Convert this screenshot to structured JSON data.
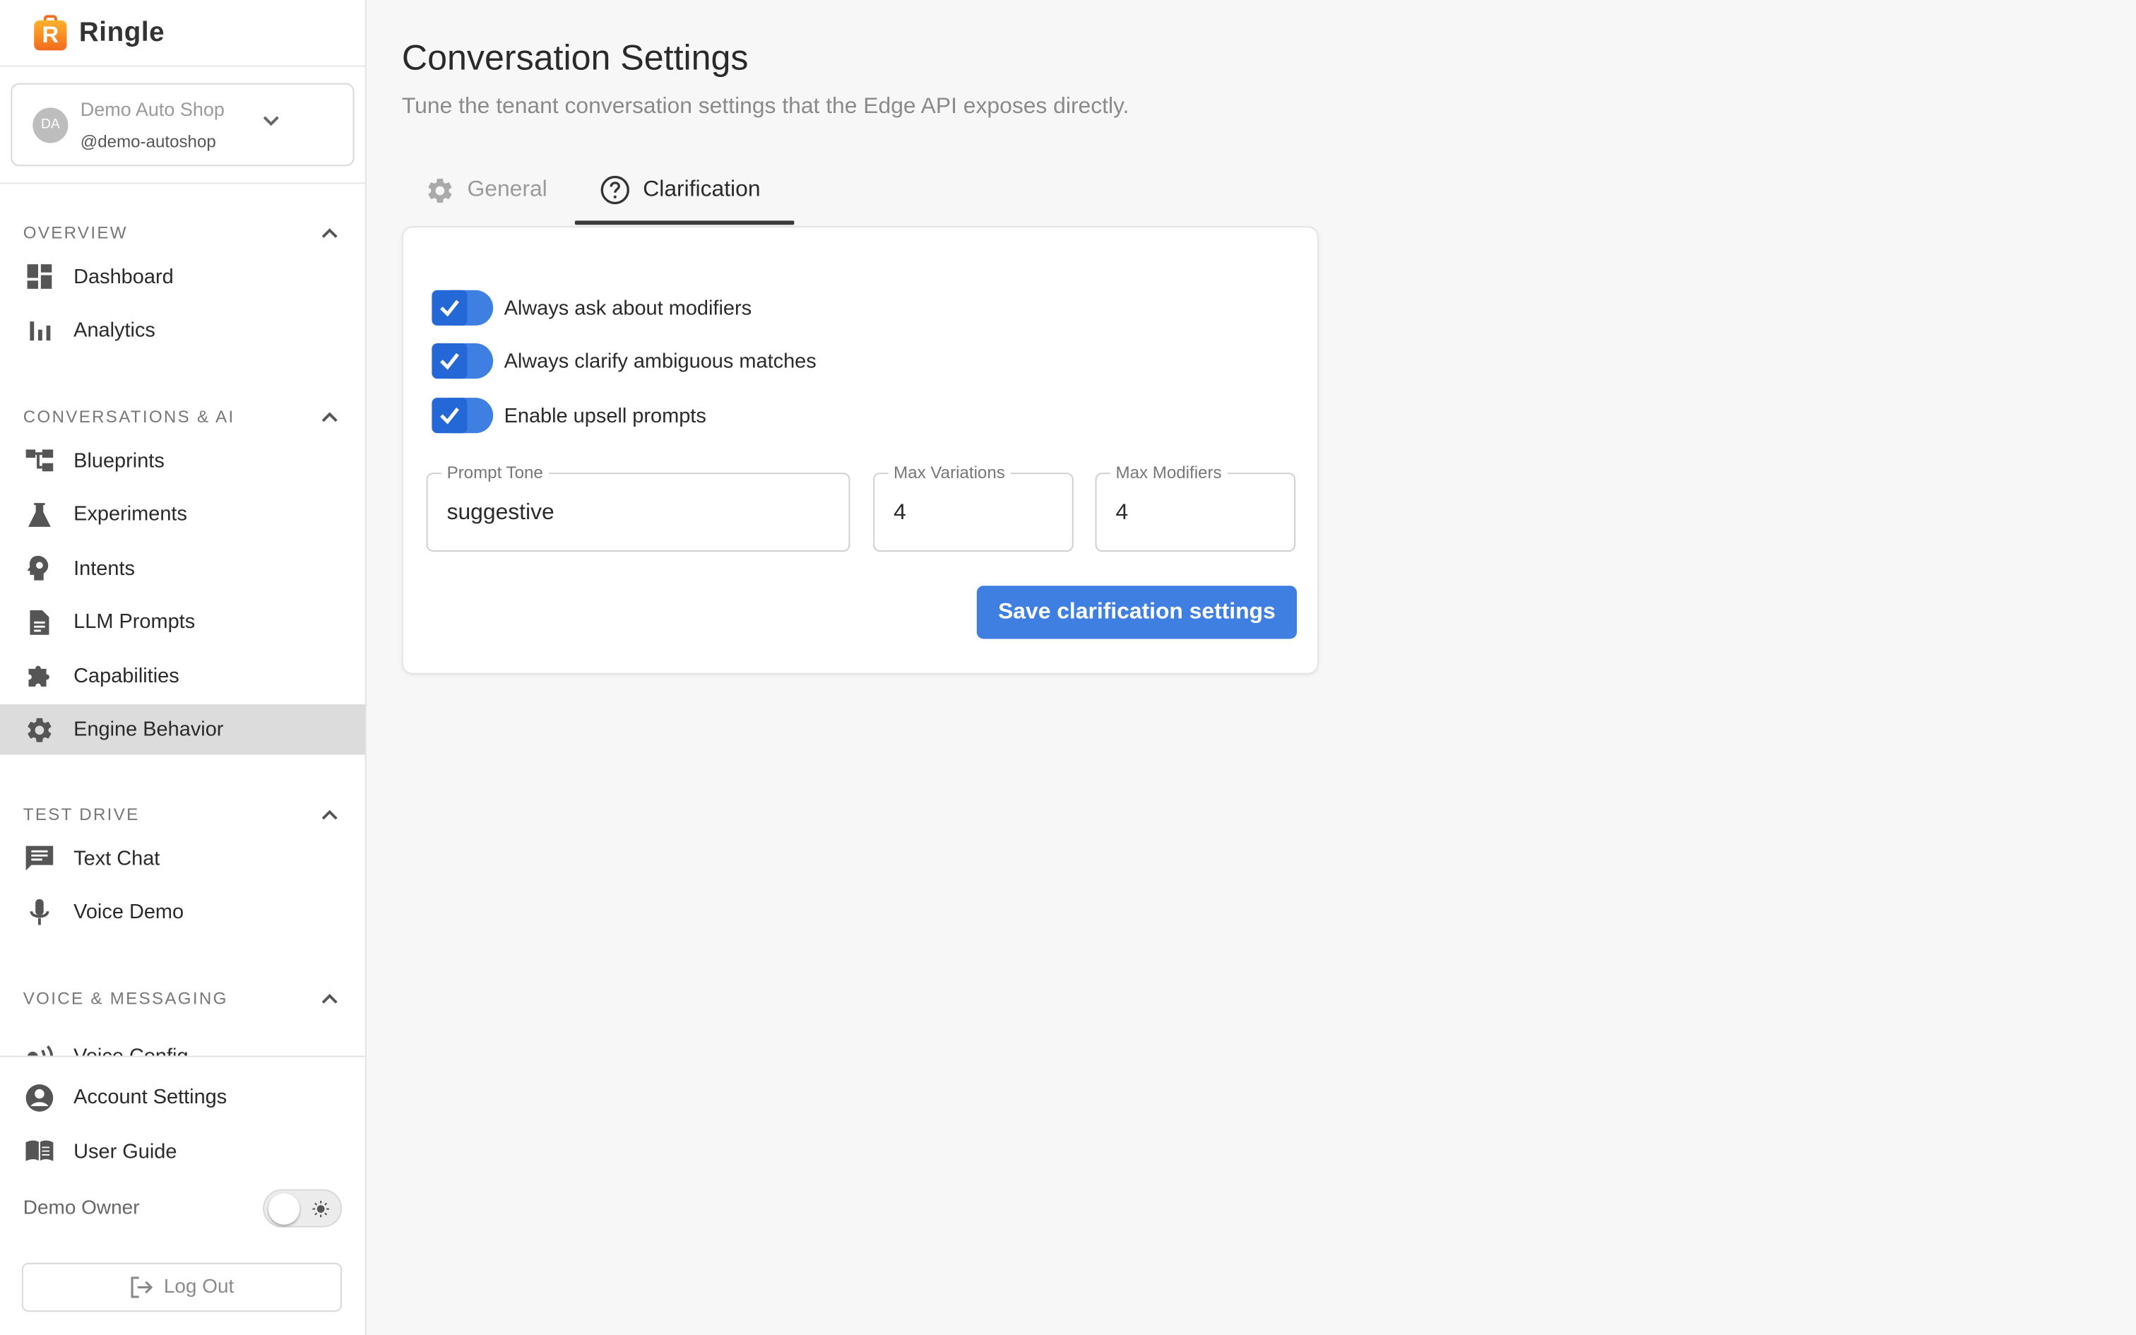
{
  "app": {
    "name": "Ringle"
  },
  "tenant": {
    "initials": "DA",
    "name": "Demo Auto Shop",
    "handle": "@demo-autoshop"
  },
  "sidebar": {
    "sections": [
      {
        "label": "OVERVIEW",
        "items": [
          {
            "label": "Dashboard",
            "icon": "dashboard-icon"
          },
          {
            "label": "Analytics",
            "icon": "bar-chart-icon"
          }
        ]
      },
      {
        "label": "CONVERSATIONS & AI",
        "items": [
          {
            "label": "Blueprints",
            "icon": "blueprint-tree-icon"
          },
          {
            "label": "Experiments",
            "icon": "flask-icon"
          },
          {
            "label": "Intents",
            "icon": "brain-head-icon"
          },
          {
            "label": "LLM Prompts",
            "icon": "document-icon"
          },
          {
            "label": "Capabilities",
            "icon": "puzzle-icon"
          },
          {
            "label": "Engine Behavior",
            "icon": "gear-icon",
            "active": true
          }
        ]
      },
      {
        "label": "TEST DRIVE",
        "items": [
          {
            "label": "Text Chat",
            "icon": "chat-icon"
          },
          {
            "label": "Voice Demo",
            "icon": "microphone-icon"
          }
        ]
      },
      {
        "label": "VOICE & MESSAGING",
        "items": [
          {
            "label": "Voice Config",
            "icon": "voice-waves-icon"
          }
        ]
      }
    ],
    "bottom": {
      "account_settings": "Account Settings",
      "user_guide": "User Guide",
      "owner": "Demo Owner",
      "logout": "Log Out",
      "theme_toggle_on": false
    }
  },
  "main": {
    "title": "Conversation Settings",
    "subtitle": "Tune the tenant conversation settings that the Edge API exposes directly.",
    "tabs": [
      {
        "label": "General",
        "icon": "gear-icon",
        "active": false
      },
      {
        "label": "Clarification",
        "icon": "help-circle-icon",
        "active": true
      }
    ],
    "clarification": {
      "toggles": [
        {
          "label": "Always ask about modifiers",
          "checked": true
        },
        {
          "label": "Always clarify ambiguous matches",
          "checked": true
        },
        {
          "label": "Enable upsell prompts",
          "checked": true
        }
      ],
      "fields": {
        "prompt_tone": {
          "label": "Prompt Tone",
          "value": "suggestive"
        },
        "max_variations": {
          "label": "Max Variations",
          "value": "4"
        },
        "max_modifiers": {
          "label": "Max Modifiers",
          "value": "4"
        }
      },
      "save_label": "Save clarification settings"
    }
  },
  "colors": {
    "accent": "#3f7fe2",
    "active_nav_bg": "#dcdcdc",
    "brand_orange": "#f26b1d"
  }
}
